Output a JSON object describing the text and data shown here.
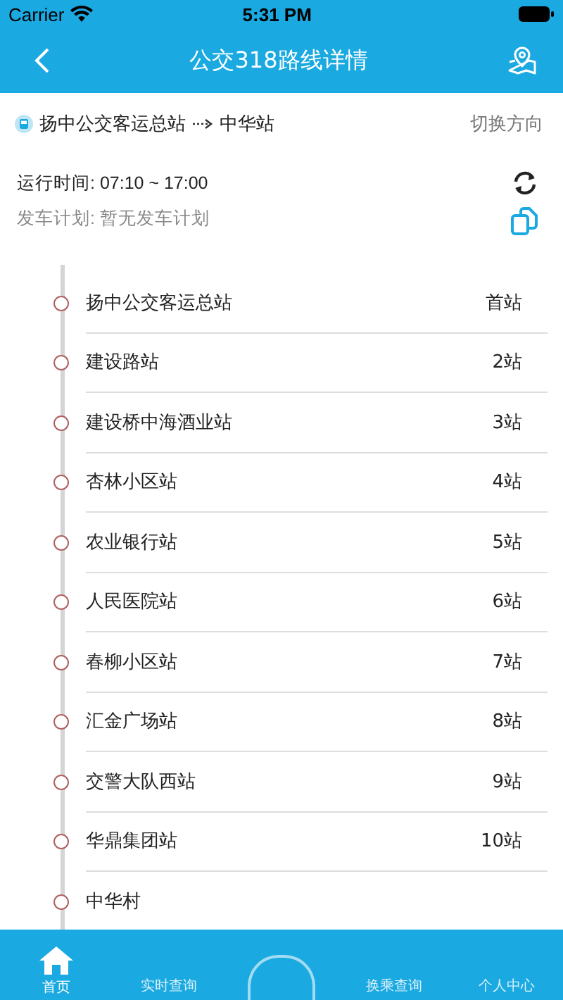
{
  "status_bar": {
    "carrier": "Carrier",
    "time": "5:31 PM"
  },
  "nav": {
    "title": "公交318路线详情"
  },
  "route": {
    "from": "扬中公交客运总站",
    "to": "中华站",
    "switch": "切换方向"
  },
  "info": {
    "hours": "运行时间: 07:10 ~ 17:00",
    "plan": "发车计划: 暂无发车计划"
  },
  "stations": [
    {
      "name": "扬中公交客运总站",
      "order": "首站"
    },
    {
      "name": "建设路站",
      "order": "2站"
    },
    {
      "name": "建设桥中海酒业站",
      "order": "3站"
    },
    {
      "name": "杏林小区站",
      "order": "4站"
    },
    {
      "name": "农业银行站",
      "order": "5站"
    },
    {
      "name": "人民医院站",
      "order": "6站"
    },
    {
      "name": "春柳小区站",
      "order": "7站"
    },
    {
      "name": "汇金广场站",
      "order": "8站"
    },
    {
      "name": "交警大队西站",
      "order": "9站"
    },
    {
      "name": "华鼎集团站",
      "order": "10站"
    },
    {
      "name": "中华村"
    }
  ],
  "tabs": [
    {
      "kind": "home",
      "label": "首页",
      "selected": true
    },
    {
      "kind": "text",
      "label": "实时查询",
      "selected": false
    },
    {
      "kind": "center",
      "selected": false
    },
    {
      "kind": "text",
      "label": "换乘查询",
      "selected": false
    },
    {
      "kind": "text",
      "label": "个人中心",
      "selected": false
    }
  ]
}
